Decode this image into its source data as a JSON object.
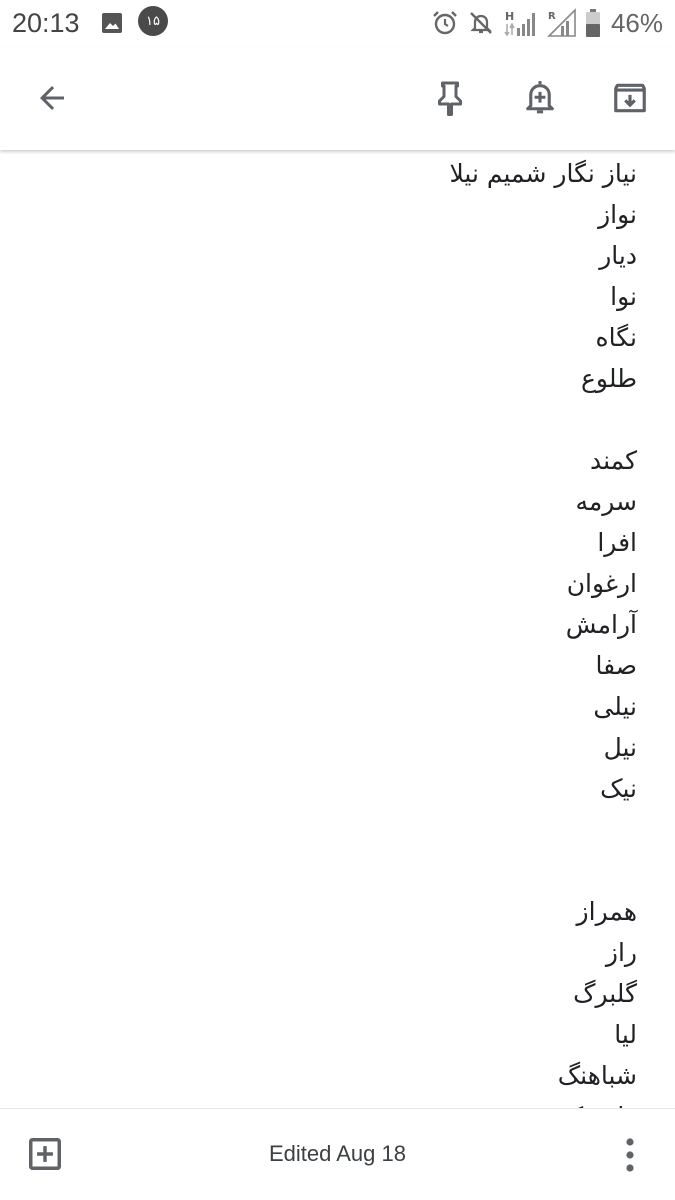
{
  "status_bar": {
    "time": "20:13",
    "notification_badge": "۱۵",
    "battery": "46%",
    "icons": [
      "image-icon",
      "alarm-icon",
      "notifications-off-icon",
      "signal-h-icon",
      "signal-r-icon",
      "battery-icon"
    ]
  },
  "app_bar": {
    "icons": [
      "arrow-back-icon",
      "pin-icon",
      "reminder-icon",
      "archive-icon"
    ]
  },
  "note": {
    "lines": [
      "نیاز نگار شمیم نیلا",
      "نواز",
      "دیار",
      "نوا",
      "نگاه",
      "طلوع",
      "",
      "کمند",
      "سرمه",
      "افرا",
      "ارغوان",
      "آرامش",
      "صفا",
      "نیلی",
      "نیل",
      "نیک",
      "",
      "",
      "همراز",
      "راز",
      "گلبرگ",
      "لیا",
      "شباهنگ",
      "قاصدک"
    ]
  },
  "bottom_bar": {
    "edited_label": "Edited Aug 18",
    "icons": [
      "add-box-icon",
      "more-vert-icon"
    ]
  },
  "colors": {
    "icon": "#5f6368",
    "text": "#202124",
    "background": "#ffffff"
  }
}
